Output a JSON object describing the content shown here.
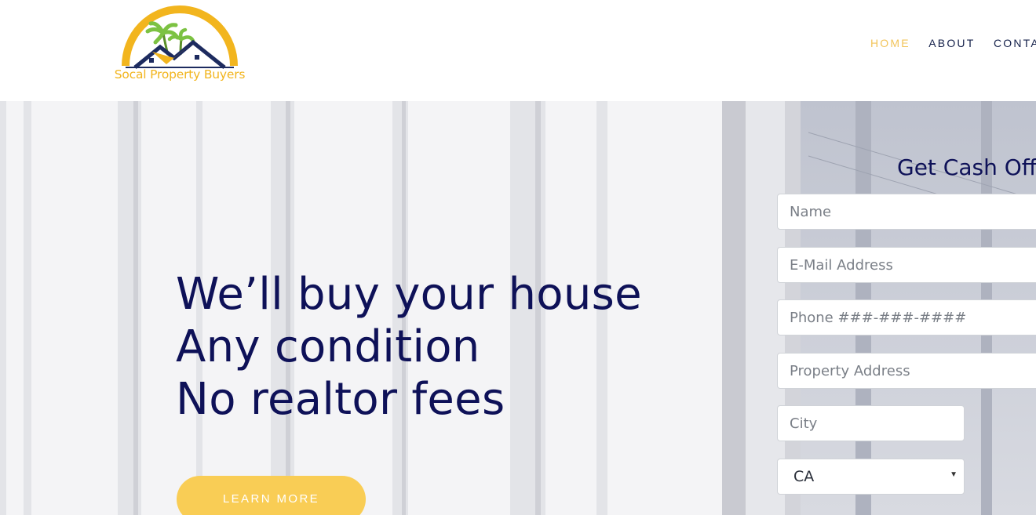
{
  "brand": {
    "name": "Socal Property Buyers",
    "colors": {
      "gold": "#f2b51e",
      "navy": "#0e1158",
      "palm_green": "#7cc242"
    }
  },
  "nav": {
    "items": [
      {
        "label": "HOME",
        "active": true
      },
      {
        "label": "ABOUT",
        "active": false
      },
      {
        "label": "CONTA",
        "active": false
      }
    ]
  },
  "hero": {
    "headline": [
      "We’ll buy your house",
      "Any condition",
      "No realtor fees"
    ],
    "cta_label": "LEARN MORE"
  },
  "form": {
    "title": "Get Cash Off",
    "fields": {
      "name": {
        "placeholder": "Name"
      },
      "email": {
        "placeholder": "E-Mail Address"
      },
      "phone": {
        "placeholder": "Phone ###-###-####"
      },
      "address": {
        "placeholder": "Property Address"
      },
      "city": {
        "placeholder": "City"
      }
    },
    "state": {
      "value": "CA"
    }
  }
}
